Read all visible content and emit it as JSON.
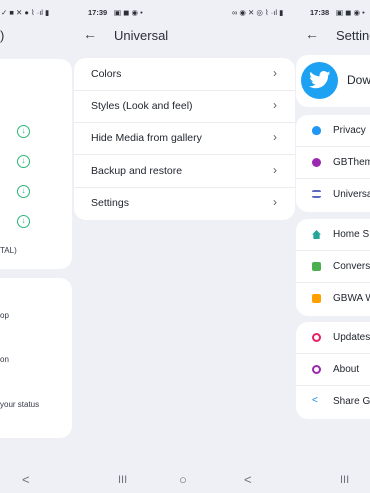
{
  "left_screen": {
    "status": {
      "icons": "✓ ■ ✕ ● ⌇ ·ıl ▮"
    },
    "header_fragment": ")",
    "downloads_count": 4,
    "footer_fragment": "TAL)",
    "privacy_items": [
      "op",
      "on",
      "your status"
    ],
    "nav": {
      "back": "<"
    }
  },
  "middle_screen": {
    "status": {
      "time": "17:39",
      "icons": "▣ ◼ ◉ •",
      "right_icons": "∞ ◉ ✕ ◎ ⌇ ·ıl ▮"
    },
    "toolbar": {
      "back_icon": "←",
      "title": "Universal"
    },
    "menu": [
      {
        "label": "Colors"
      },
      {
        "label": "Styles (Look and feel)"
      },
      {
        "label": "Hide Media from gallery"
      },
      {
        "label": "Backup and restore"
      },
      {
        "label": "Settings"
      }
    ],
    "chevron": "›",
    "nav": {
      "recents": "III",
      "home": "○",
      "back": "<"
    }
  },
  "right_screen": {
    "status": {
      "time": "17:38",
      "icons": "▣ ◼ ◉ •"
    },
    "toolbar": {
      "back_icon": "←",
      "title": "Setting"
    },
    "banner": {
      "label": "Dow",
      "bird": "🐦"
    },
    "group1": [
      {
        "label": "Privacy",
        "color": "#2196f3"
      },
      {
        "label": "GBThem",
        "color": "#9c27b0"
      },
      {
        "label": "Universa",
        "color": "#5c6bc0"
      }
    ],
    "group2": [
      {
        "label": "Home S",
        "color": "#26a69a"
      },
      {
        "label": "Convers",
        "color": "#4caf50"
      },
      {
        "label": "GBWA W",
        "color": "#ffa000"
      }
    ],
    "group3": [
      {
        "label": "Updates",
        "color": "#e91e63"
      },
      {
        "label": "About",
        "color": "#9c27b0"
      },
      {
        "label": "Share G",
        "color": "#1e88e5"
      }
    ],
    "nav": {
      "recents": "III"
    }
  },
  "colors": {
    "background": "#eef0f6",
    "card": "#ffffff",
    "download_green": "#2bb673",
    "twitter_blue": "#1da1f2"
  }
}
